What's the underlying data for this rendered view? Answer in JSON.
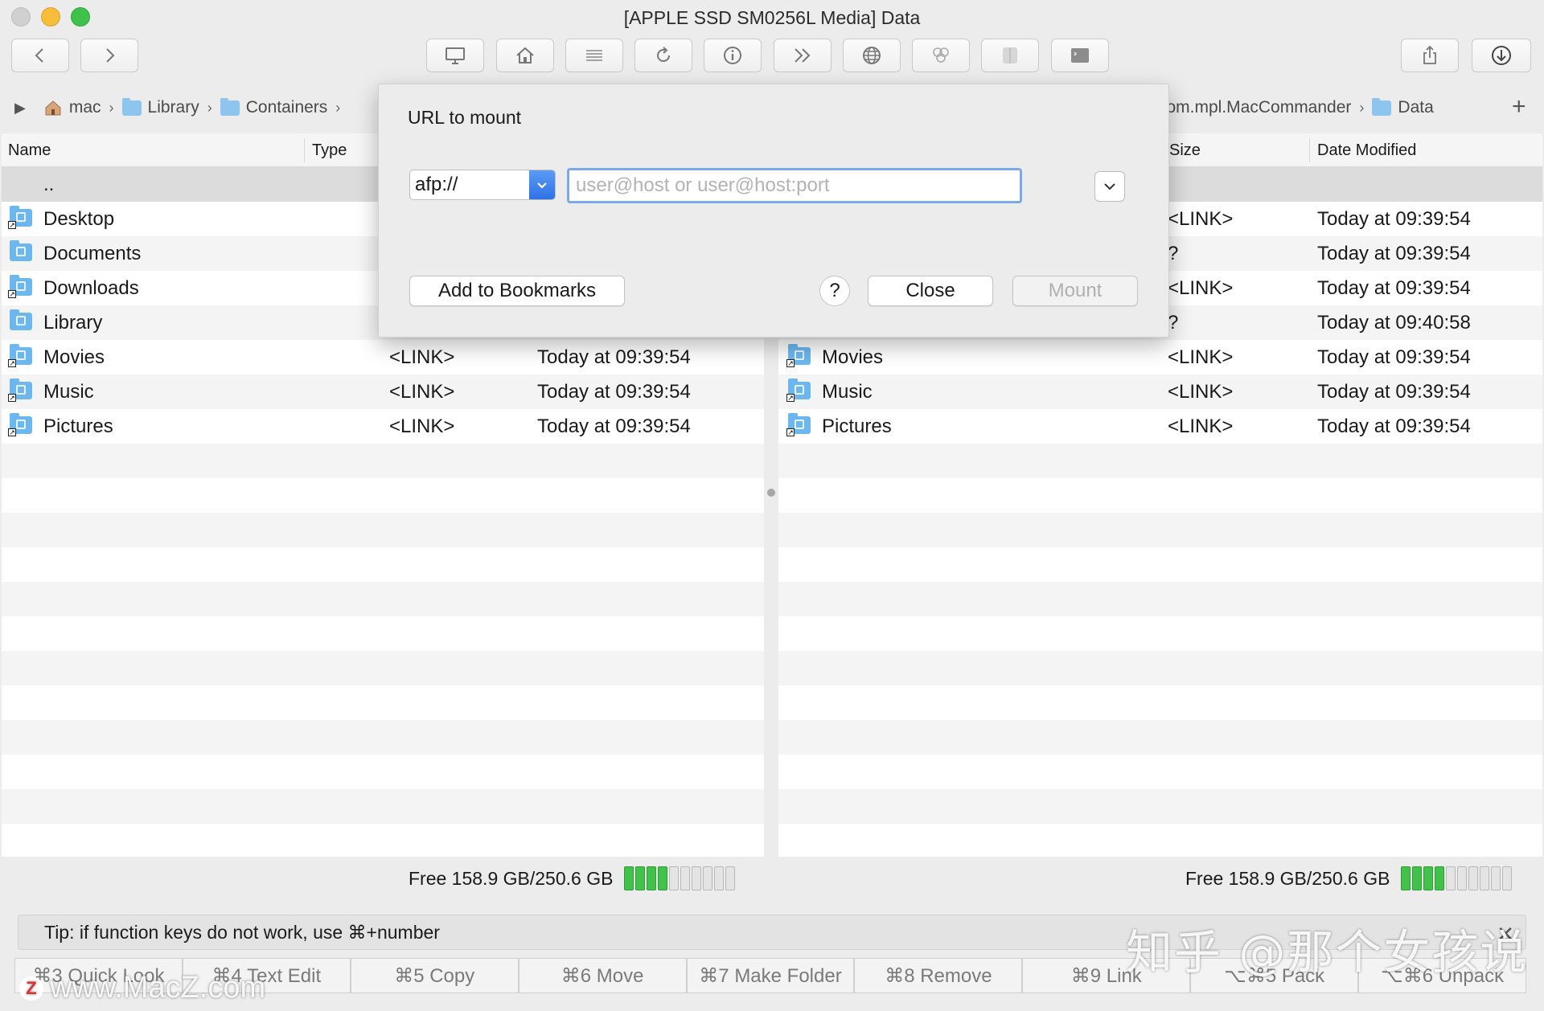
{
  "window": {
    "title": "[APPLE SSD SM0256L Media] Data"
  },
  "toolbar": {
    "buttons": [
      "back-icon",
      "forward-icon",
      "computer-icon",
      "home-icon",
      "list-icon",
      "refresh-icon",
      "info-icon",
      "fast-forward-icon",
      "globe-icon",
      "network-icon",
      "finder-icon",
      "terminal-icon",
      "share-icon",
      "download-icon"
    ]
  },
  "left_breadcrumb": [
    {
      "label": "mac",
      "icon": "home-icon"
    },
    {
      "label": "Library",
      "icon": "folder-icon"
    },
    {
      "label": "Containers",
      "icon": "folder-icon"
    }
  ],
  "right_breadcrumb": [
    {
      "label": "com.mpl.MacCommander",
      "icon": "folder-icon"
    },
    {
      "label": "Data",
      "icon": "folder-icon"
    }
  ],
  "left_pane": {
    "columns": {
      "name": "Name",
      "type": "Type"
    },
    "rows": [
      {
        "name": "..",
        "size": "",
        "date": "",
        "icon": ""
      },
      {
        "name": "Desktop",
        "size": "",
        "date": "",
        "icon": "desktop-folder-icon"
      },
      {
        "name": "Documents",
        "size": "",
        "date": "",
        "icon": "folder-icon"
      },
      {
        "name": "Downloads",
        "size": "",
        "date": "",
        "icon": "downloads-folder-icon"
      },
      {
        "name": "Library",
        "size": "",
        "date": "",
        "icon": "folder-icon"
      },
      {
        "name": "Movies",
        "size": "<LINK>",
        "date": "Today at 09:39:54",
        "icon": "movies-folder-icon"
      },
      {
        "name": "Music",
        "size": "<LINK>",
        "date": "Today at 09:39:54",
        "icon": "music-folder-icon"
      },
      {
        "name": "Pictures",
        "size": "<LINK>",
        "date": "Today at 09:39:54",
        "icon": "pictures-folder-icon"
      }
    ],
    "free": "Free 158.9 GB/250.6 GB",
    "used_fraction": 0.37
  },
  "right_pane": {
    "columns": {
      "size": "Size",
      "date": "Date Modified"
    },
    "rows": [
      {
        "name": "",
        "size": "",
        "date": "",
        "icon": ""
      },
      {
        "name": "",
        "size": "<LINK>",
        "date": "Today at 09:39:54",
        "icon": ""
      },
      {
        "name": "",
        "size": "?",
        "date": "Today at 09:39:54",
        "icon": ""
      },
      {
        "name": "",
        "size": "<LINK>",
        "date": "Today at 09:39:54",
        "icon": ""
      },
      {
        "name": "",
        "size": "?",
        "date": "Today at 09:40:58",
        "icon": ""
      },
      {
        "name": "Movies",
        "size": "<LINK>",
        "date": "Today at 09:39:54",
        "icon": "movies-folder-icon"
      },
      {
        "name": "Music",
        "size": "<LINK>",
        "date": "Today at 09:39:54",
        "icon": "music-folder-icon"
      },
      {
        "name": "Pictures",
        "size": "<LINK>",
        "date": "Today at 09:39:54",
        "icon": "pictures-folder-icon"
      }
    ],
    "free": "Free 158.9 GB/250.6 GB",
    "used_fraction": 0.37
  },
  "dialog": {
    "title": "URL to mount",
    "protocol": "afp://",
    "url_value": "",
    "url_placeholder": "user@host or user@host:port",
    "add_bookmarks": "Add to Bookmarks",
    "help": "?",
    "close": "Close",
    "mount": "Mount"
  },
  "tip": "Tip: if function keys do not work, use ⌘+number",
  "fkeys": [
    "⌘3 Quick Look",
    "⌘4 Text Edit",
    "⌘5 Copy",
    "⌘6 Move",
    "⌘7 Make Folder",
    "⌘8 Remove",
    "⌘9 Link",
    "⌥⌘5 Pack",
    "⌥⌘6 Unpack"
  ],
  "watermarks": {
    "zhihu": "知乎 @那个女孩说",
    "site": "www.MacZ.com",
    "site_logo": "Z"
  },
  "colors": {
    "accent": "#2f72e6",
    "gauge_used": "#43c24b",
    "folder": "#6cb8ee"
  }
}
